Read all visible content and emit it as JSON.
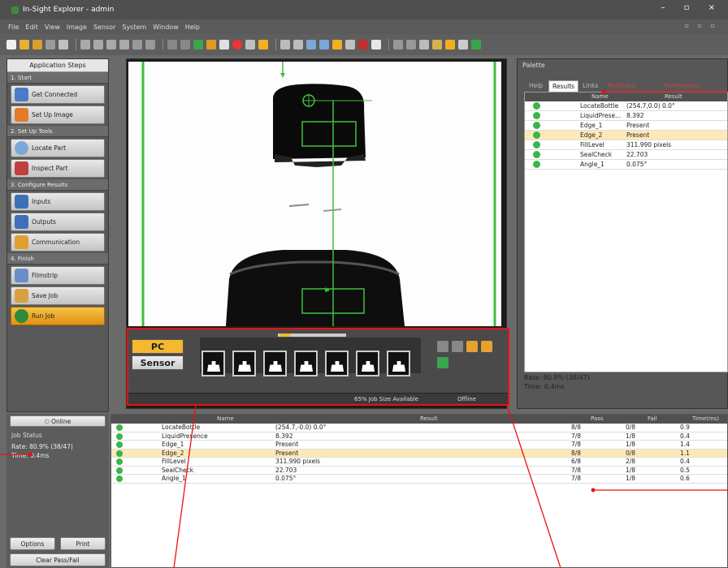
{
  "window": {
    "title": "In-Sight Explorer - admin",
    "controls": "– ▫ ×"
  },
  "menu": [
    "File",
    "Edit",
    "View",
    "Image",
    "Sensor",
    "System",
    "Window",
    "Help"
  ],
  "app_steps": {
    "title": "Application Steps",
    "sections": [
      {
        "label": "1. Start",
        "items": [
          "Get Connected",
          "Set Up Image"
        ]
      },
      {
        "label": "2. Set Up Tools",
        "items": [
          "Locate Part",
          "Inspect Part"
        ]
      },
      {
        "label": "3. Configure Results",
        "items": [
          "Inputs",
          "Outputs",
          "Communication"
        ]
      },
      {
        "label": "4. Finish",
        "items": [
          "Filmstrip",
          "Save Job",
          "Run Job"
        ]
      }
    ]
  },
  "film": {
    "pc": "PC",
    "sensor": "Sensor",
    "job_size": "65% Job Size Available",
    "status": "Offline"
  },
  "palette": {
    "title": "Palette",
    "tabs": [
      "Help",
      "Results",
      "Links",
      "TestRun©",
      "Permissions"
    ],
    "col_name": "Name",
    "col_result": "Result",
    "rows": [
      {
        "name": "LocateBottle",
        "result": "(254.7,0.0) 0.0°"
      },
      {
        "name": "LiquidPrese...",
        "result": "8.392"
      },
      {
        "name": "Edge_1",
        "result": "Present"
      },
      {
        "name": "Edge_2",
        "result": "Present"
      },
      {
        "name": "FillLevel",
        "result": "311.990 pixels"
      },
      {
        "name": "SealCheck",
        "result": "22.703"
      },
      {
        "name": "Angle_1",
        "result": "0.075°"
      }
    ],
    "rate": "Rate: 80.9% (38/47)",
    "time": "Time: 0.4ms"
  },
  "online": "Online",
  "job_status": {
    "title": "Job Status",
    "rate": "Rate: 80.9% (38/47)",
    "time": "Time: 0.4ms"
  },
  "buttons": {
    "options": "Options",
    "print": "Print",
    "clear": "Clear Pass/Fail"
  },
  "bottom_table": {
    "cols": [
      "Name",
      "Result",
      "Pass",
      "Fail",
      "Time(ms)"
    ],
    "rows": [
      {
        "name": "LocateBottle",
        "result": "(254.7,-0.0) 0.0°",
        "pass": "8/8",
        "fail": "0/8",
        "time": "0.9"
      },
      {
        "name": "LiquidPresence",
        "result": "8.392",
        "pass": "7/8",
        "fail": "1/8",
        "time": "0.4"
      },
      {
        "name": "Edge_1",
        "result": "Present",
        "pass": "7/8",
        "fail": "1/8",
        "time": "1.4"
      },
      {
        "name": "Edge_2",
        "result": "Present",
        "pass": "8/8",
        "fail": "0/8",
        "time": "1.1"
      },
      {
        "name": "FillLevel",
        "result": "311.990 pixels",
        "pass": "6/8",
        "fail": "2/8",
        "time": "0.4"
      },
      {
        "name": "SealCheck",
        "result": "22.703",
        "pass": "7/8",
        "fail": "1/8",
        "time": "0.5"
      },
      {
        "name": "Angle_1",
        "result": "0.075°",
        "pass": "7/8",
        "fail": "1/8",
        "time": "0.6"
      }
    ]
  }
}
